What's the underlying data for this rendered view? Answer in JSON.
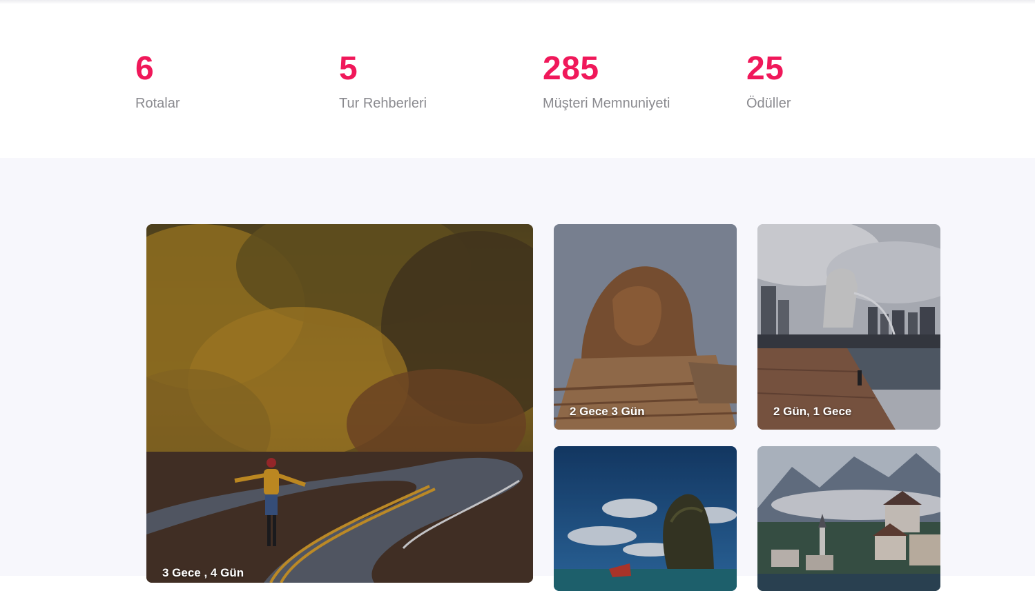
{
  "stats": [
    {
      "value": "6",
      "label": "Rotalar"
    },
    {
      "value": "5",
      "label": "Tur Rehberleri"
    },
    {
      "value": "285",
      "label": "Müşteri Memnuniyeti"
    },
    {
      "value": "25",
      "label": "Ödüller"
    }
  ],
  "tours": [
    {
      "duration": "3 Gece , 4 Gün",
      "image": "autumn-forest-road"
    },
    {
      "duration": "2 Gece 3 Gün",
      "image": "egypt-sphinx"
    },
    {
      "duration": "2 Gün, 1 Gece",
      "image": "singapore-merlion"
    },
    {
      "duration": "",
      "image": "thailand-rock-island"
    },
    {
      "duration": "",
      "image": "hallstatt-mountain-village"
    }
  ],
  "colors": {
    "accent": "#f0185a",
    "label": "#8a8a8f",
    "gallery_background": "#f7f7fc"
  }
}
